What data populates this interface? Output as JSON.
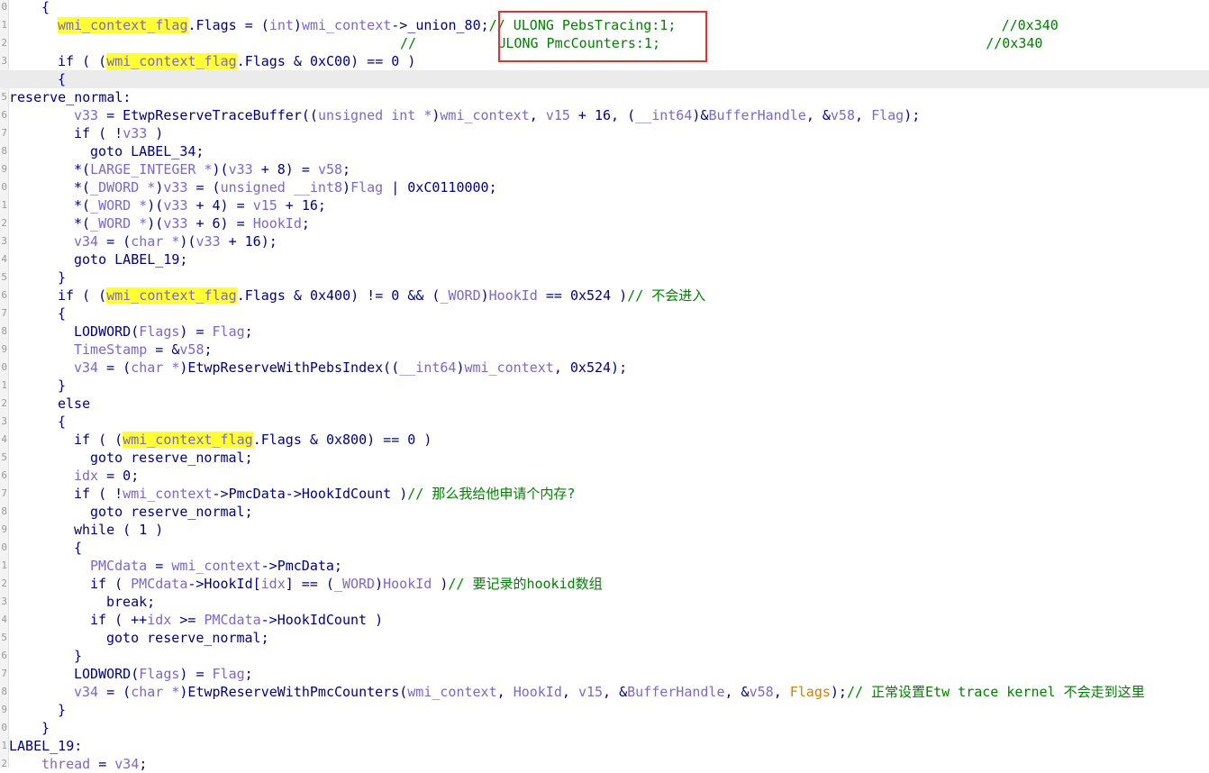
{
  "gutter_numbers": [
    "0",
    "1",
    "2",
    "3",
    "4",
    "5",
    "6",
    "7",
    "8",
    "9",
    "0",
    "1",
    "2",
    "3",
    "4",
    "5",
    "6",
    "7",
    "8",
    "9",
    "0",
    "1",
    "2",
    "3",
    "4",
    "5",
    "6",
    "7",
    "8",
    "9",
    "0",
    "1",
    "2",
    "3",
    "4",
    "5",
    "6",
    "7",
    "8",
    "9",
    "0",
    "1",
    "2"
  ],
  "lines": [
    [
      {
        "t": "{",
        "s": "p"
      }
    ],
    [
      {
        "t": "wmi_context_flag",
        "s": "y"
      },
      {
        "t": ".Flags = (",
        "s": "p"
      },
      {
        "t": "int",
        "s": "v"
      },
      {
        "t": ")",
        "s": "p"
      },
      {
        "t": "wmi_context",
        "s": "v"
      },
      {
        "t": "->_union_80;",
        "s": "p"
      },
      {
        "t": "// ULONG PebsTracing:1;                                        //0x340",
        "s": "c"
      }
    ],
    [
      {
        "t": "//          ULONG PmcCounters:1;                                        //0x340",
        "s": "c"
      }
    ],
    [
      {
        "t": "if ( (",
        "s": "p"
      },
      {
        "t": "wmi_context_flag",
        "s": "y"
      },
      {
        "t": ".Flags & 0xC00) == 0 )",
        "s": "p"
      }
    ],
    [
      {
        "t": "{",
        "s": "p"
      }
    ],
    [
      {
        "t": "reserve_normal:",
        "s": "p"
      }
    ],
    [
      {
        "t": "v33",
        "s": "v"
      },
      {
        "t": " = EtwpReserveTraceBuffer((",
        "s": "p"
      },
      {
        "t": "unsigned int *",
        "s": "v"
      },
      {
        "t": ")",
        "s": "p"
      },
      {
        "t": "wmi_context",
        "s": "v"
      },
      {
        "t": ", ",
        "s": "p"
      },
      {
        "t": "v15",
        "s": "v"
      },
      {
        "t": " + 16, (",
        "s": "p"
      },
      {
        "t": "__int64",
        "s": "v"
      },
      {
        "t": ")&",
        "s": "p"
      },
      {
        "t": "BufferHandle",
        "s": "v"
      },
      {
        "t": ", &",
        "s": "p"
      },
      {
        "t": "v58",
        "s": "v"
      },
      {
        "t": ", ",
        "s": "p"
      },
      {
        "t": "Flag",
        "s": "v"
      },
      {
        "t": ");",
        "s": "p"
      }
    ],
    [
      {
        "t": "if ( !",
        "s": "p"
      },
      {
        "t": "v33",
        "s": "v"
      },
      {
        "t": " )",
        "s": "p"
      }
    ],
    [
      {
        "t": "goto LABEL_34;",
        "s": "p"
      }
    ],
    [
      {
        "t": "*(",
        "s": "p"
      },
      {
        "t": "LARGE_INTEGER *",
        "s": "v"
      },
      {
        "t": ")(",
        "s": "p"
      },
      {
        "t": "v33",
        "s": "v"
      },
      {
        "t": " + 8) = ",
        "s": "p"
      },
      {
        "t": "v58",
        "s": "v"
      },
      {
        "t": ";",
        "s": "p"
      }
    ],
    [
      {
        "t": "*(",
        "s": "p"
      },
      {
        "t": "_DWORD *",
        "s": "v"
      },
      {
        "t": ")",
        "s": "p"
      },
      {
        "t": "v33",
        "s": "v"
      },
      {
        "t": " = (",
        "s": "p"
      },
      {
        "t": "unsigned __int8",
        "s": "v"
      },
      {
        "t": ")",
        "s": "p"
      },
      {
        "t": "Flag",
        "s": "v"
      },
      {
        "t": " | 0xC0110000;",
        "s": "p"
      }
    ],
    [
      {
        "t": "*(",
        "s": "p"
      },
      {
        "t": "_WORD *",
        "s": "v"
      },
      {
        "t": ")(",
        "s": "p"
      },
      {
        "t": "v33",
        "s": "v"
      },
      {
        "t": " + 4) = ",
        "s": "p"
      },
      {
        "t": "v15",
        "s": "v"
      },
      {
        "t": " + 16;",
        "s": "p"
      }
    ],
    [
      {
        "t": "*(",
        "s": "p"
      },
      {
        "t": "_WORD *",
        "s": "v"
      },
      {
        "t": ")(",
        "s": "p"
      },
      {
        "t": "v33",
        "s": "v"
      },
      {
        "t": " + 6) = ",
        "s": "p"
      },
      {
        "t": "HookId",
        "s": "v"
      },
      {
        "t": ";",
        "s": "p"
      }
    ],
    [
      {
        "t": "v34",
        "s": "v"
      },
      {
        "t": " = (",
        "s": "p"
      },
      {
        "t": "char *",
        "s": "v"
      },
      {
        "t": ")(",
        "s": "p"
      },
      {
        "t": "v33",
        "s": "v"
      },
      {
        "t": " + 16);",
        "s": "p"
      }
    ],
    [
      {
        "t": "goto LABEL_19;",
        "s": "p"
      }
    ],
    [
      {
        "t": "}",
        "s": "p"
      }
    ],
    [
      {
        "t": "if ( (",
        "s": "p"
      },
      {
        "t": "wmi_context_flag",
        "s": "y"
      },
      {
        "t": ".Flags & 0x400) != 0 && (",
        "s": "p"
      },
      {
        "t": "_WORD",
        "s": "v"
      },
      {
        "t": ")",
        "s": "p"
      },
      {
        "t": "HookId",
        "s": "v"
      },
      {
        "t": " == 0x524 )",
        "s": "p"
      },
      {
        "t": "// 不会进入",
        "s": "c"
      }
    ],
    [
      {
        "t": "{",
        "s": "p"
      }
    ],
    [
      {
        "t": "LODWORD(",
        "s": "p"
      },
      {
        "t": "Flags",
        "s": "v"
      },
      {
        "t": ") = ",
        "s": "p"
      },
      {
        "t": "Flag",
        "s": "v"
      },
      {
        "t": ";",
        "s": "p"
      }
    ],
    [
      {
        "t": "TimeStamp",
        "s": "v"
      },
      {
        "t": " = &",
        "s": "p"
      },
      {
        "t": "v58",
        "s": "v"
      },
      {
        "t": ";",
        "s": "p"
      }
    ],
    [
      {
        "t": "v34",
        "s": "v"
      },
      {
        "t": " = (",
        "s": "p"
      },
      {
        "t": "char *",
        "s": "v"
      },
      {
        "t": ")EtwpReserveWithPebsIndex((",
        "s": "p"
      },
      {
        "t": "__int64",
        "s": "v"
      },
      {
        "t": ")",
        "s": "p"
      },
      {
        "t": "wmi_context",
        "s": "v"
      },
      {
        "t": ", 0x524);",
        "s": "p"
      }
    ],
    [
      {
        "t": "}",
        "s": "p"
      }
    ],
    [
      {
        "t": "else",
        "s": "p"
      }
    ],
    [
      {
        "t": "{",
        "s": "p"
      }
    ],
    [
      {
        "t": "if ( (",
        "s": "p"
      },
      {
        "t": "wmi_context_flag",
        "s": "y"
      },
      {
        "t": ".Flags & 0x800) == 0 )",
        "s": "p"
      }
    ],
    [
      {
        "t": "goto reserve_normal;",
        "s": "p"
      }
    ],
    [
      {
        "t": "idx",
        "s": "v"
      },
      {
        "t": " = 0;",
        "s": "p"
      }
    ],
    [
      {
        "t": "if ( !",
        "s": "p"
      },
      {
        "t": "wmi_context",
        "s": "v"
      },
      {
        "t": "->PmcData->HookIdCount )",
        "s": "p"
      },
      {
        "t": "// 那么我给他申请个内存?",
        "s": "c"
      }
    ],
    [
      {
        "t": "goto reserve_normal;",
        "s": "p"
      }
    ],
    [
      {
        "t": "while ( 1 )",
        "s": "p"
      }
    ],
    [
      {
        "t": "{",
        "s": "p"
      }
    ],
    [
      {
        "t": "PMCdata",
        "s": "v"
      },
      {
        "t": " = ",
        "s": "p"
      },
      {
        "t": "wmi_context",
        "s": "v"
      },
      {
        "t": "->PmcData;",
        "s": "p"
      }
    ],
    [
      {
        "t": "if ( ",
        "s": "p"
      },
      {
        "t": "PMCdata",
        "s": "v"
      },
      {
        "t": "->HookId[",
        "s": "p"
      },
      {
        "t": "idx",
        "s": "v"
      },
      {
        "t": "] == (",
        "s": "p"
      },
      {
        "t": "_WORD",
        "s": "v"
      },
      {
        "t": ")",
        "s": "p"
      },
      {
        "t": "HookId",
        "s": "v"
      },
      {
        "t": " )",
        "s": "p"
      },
      {
        "t": "// 要记录的hookid数组",
        "s": "c"
      }
    ],
    [
      {
        "t": "break;",
        "s": "p"
      }
    ],
    [
      {
        "t": "if ( ++",
        "s": "p"
      },
      {
        "t": "idx",
        "s": "v"
      },
      {
        "t": " >= ",
        "s": "p"
      },
      {
        "t": "PMCdata",
        "s": "v"
      },
      {
        "t": "->HookIdCount )",
        "s": "p"
      }
    ],
    [
      {
        "t": "goto reserve_normal;",
        "s": "p"
      }
    ],
    [
      {
        "t": "}",
        "s": "p"
      }
    ],
    [
      {
        "t": "LODWORD(",
        "s": "p"
      },
      {
        "t": "Flags",
        "s": "v"
      },
      {
        "t": ") = ",
        "s": "p"
      },
      {
        "t": "Flag",
        "s": "v"
      },
      {
        "t": ";",
        "s": "p"
      }
    ],
    [
      {
        "t": "v34",
        "s": "v"
      },
      {
        "t": " = (",
        "s": "p"
      },
      {
        "t": "char *",
        "s": "v"
      },
      {
        "t": ")EtwpReserveWithPmcCounters(",
        "s": "p"
      },
      {
        "t": "wmi_context",
        "s": "v"
      },
      {
        "t": ", ",
        "s": "p"
      },
      {
        "t": "HookId",
        "s": "v"
      },
      {
        "t": ", ",
        "s": "p"
      },
      {
        "t": "v15",
        "s": "v"
      },
      {
        "t": ", &",
        "s": "p"
      },
      {
        "t": "BufferHandle",
        "s": "v"
      },
      {
        "t": ", &",
        "s": "p"
      },
      {
        "t": "v58",
        "s": "v"
      },
      {
        "t": ", ",
        "s": "p"
      },
      {
        "t": "Flags",
        "s": "o"
      },
      {
        "t": ");",
        "s": "p"
      },
      {
        "t": "// 正常设置Etw trace kernel 不会走到这里",
        "s": "c"
      }
    ],
    [
      {
        "t": "}",
        "s": "p"
      }
    ],
    [
      {
        "t": "}",
        "s": "p"
      }
    ],
    [
      {
        "t": "LABEL_19:",
        "s": "p"
      }
    ],
    [
      {
        "t": "thread",
        "s": "v"
      },
      {
        "t": " = ",
        "s": "p"
      },
      {
        "t": "v34",
        "s": "v"
      },
      {
        "t": ";",
        "s": "p"
      }
    ]
  ],
  "highlighted_line": 4,
  "colors": {
    "keyword_text": "#000080",
    "variable": "#7b68c8",
    "comment": "#008000",
    "highlight": "#ffff33",
    "annotation_box": "#e03030",
    "current_line": "#ebebeb"
  }
}
